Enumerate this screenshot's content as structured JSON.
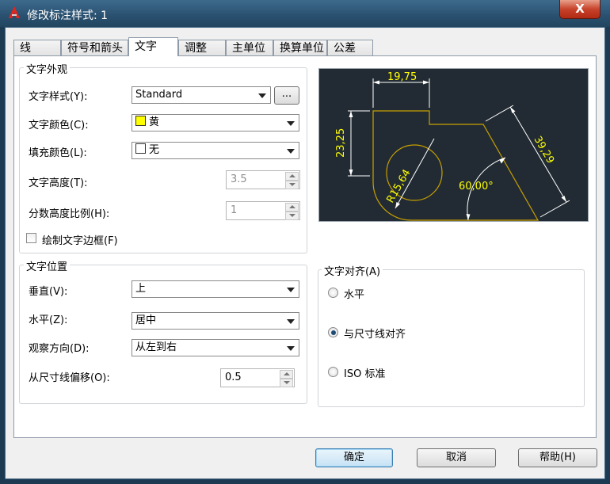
{
  "window": {
    "title": "修改标注样式: 1",
    "close": "X"
  },
  "tabs": [
    "线",
    "符号和箭头",
    "文字",
    "调整",
    "主单位",
    "换算单位",
    "公差"
  ],
  "text_appearance": {
    "group_label": "文字外观",
    "style_label": "文字样式(Y):",
    "style_value": "Standard",
    "style_more": "...",
    "color_label": "文字颜色(C):",
    "color_value": "黄",
    "color_swatch": "#ffff00",
    "fill_label": "填充颜色(L):",
    "fill_value": "无",
    "height_label": "文字高度(T):",
    "height_value": "3.5",
    "fraction_label": "分数高度比例(H):",
    "fraction_value": "1",
    "frame_label": "绘制文字边框(F)"
  },
  "text_placement": {
    "group_label": "文字位置",
    "vertical_label": "垂直(V):",
    "vertical_value": "上",
    "horizontal_label": "水平(Z):",
    "horizontal_value": "居中",
    "view_label": "观察方向(D):",
    "view_value": "从左到右",
    "offset_label": "从尺寸线偏移(O):",
    "offset_value": "0.5"
  },
  "text_alignment": {
    "group_label": "文字对齐(A)",
    "options": [
      "水平",
      "与尺寸线对齐",
      "ISO 标准"
    ],
    "selected": 1
  },
  "preview": {
    "dim_top": "19,75",
    "dim_left": "23,25",
    "dim_right": "39,29",
    "dim_radius": "R15,64",
    "dim_angle": "60,00°",
    "line_color": "#c8a000",
    "text_color": "#ffff00",
    "dim_color": "#ffffff"
  },
  "buttons": {
    "ok": "确定",
    "cancel": "取消",
    "help": "帮助(H)"
  }
}
